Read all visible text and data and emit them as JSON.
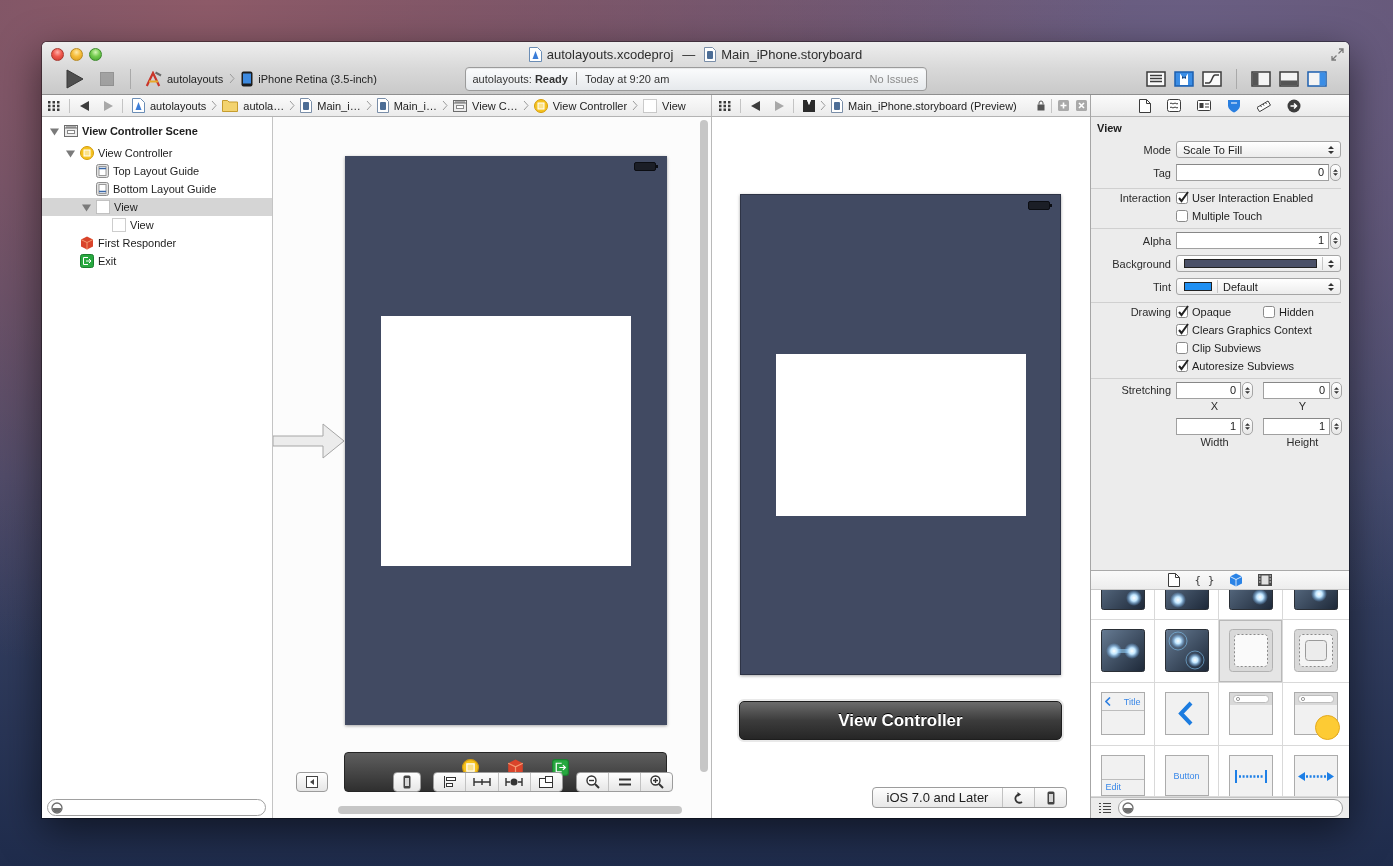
{
  "window": {
    "project": "autolayouts.xcodeproj",
    "separator": "—",
    "document": "Main_iPhone.storyboard"
  },
  "toolbar": {
    "stop_enabled": false,
    "scheme": "autolayouts",
    "destination": "iPhone Retina (3.5-inch)",
    "activity": {
      "status": "autolayouts: **Ready**",
      "time": "Today at 9:20 am",
      "issues": "No Issues"
    },
    "editor_modes": [
      {
        "kind": "standard",
        "selected": false
      },
      {
        "kind": "assistant",
        "selected": true
      },
      {
        "kind": "version",
        "selected": false
      }
    ],
    "view_toggles": [
      {
        "kind": "navigator",
        "selected": false
      },
      {
        "kind": "debug",
        "selected": false
      },
      {
        "kind": "utilities",
        "selected": true
      }
    ]
  },
  "editor": {
    "history": {
      "back_enabled": true,
      "forward_enabled": false
    },
    "jump_bar": [
      {
        "kind": "project",
        "label": "autolayouts"
      },
      {
        "kind": "folder",
        "label": "autola…"
      },
      {
        "kind": "storyboard",
        "label": "Main_i…"
      },
      {
        "kind": "storyboard",
        "label": "Main_i…"
      },
      {
        "kind": "scene",
        "label": "View C…"
      },
      {
        "kind": "controller",
        "label": "View Controller"
      },
      {
        "kind": "view",
        "label": "View"
      }
    ],
    "outline": [
      {
        "kind": "scene",
        "label": "View Controller Scene",
        "expanded": true,
        "selected": false,
        "children": [
          {
            "kind": "controller",
            "label": "View Controller",
            "expanded": true,
            "selected": false,
            "children": [
              {
                "kind": "top-guide",
                "label": "Top Layout Guide",
                "selected": false
              },
              {
                "kind": "bottom-guide",
                "label": "Bottom Layout Guide",
                "selected": false
              },
              {
                "kind": "view",
                "label": "View",
                "expanded": true,
                "selected": true,
                "children": [
                  {
                    "kind": "view",
                    "label": "View",
                    "selected": false
                  }
                ]
              }
            ]
          },
          {
            "kind": "responder",
            "label": "First Responder",
            "selected": false
          },
          {
            "kind": "exit",
            "label": "Exit",
            "selected": false
          }
        ]
      }
    ]
  },
  "assistant": {
    "history": {
      "back_enabled": true,
      "forward_enabled": false
    },
    "jump_bar": [
      {
        "kind": "storyboard",
        "label": "Main_iPhone.storyboard (Preview)"
      }
    ],
    "preview_title": "View Controller",
    "deployment": "iOS 7.0 and Later"
  },
  "inspector": {
    "tabs": [
      {
        "kind": "file",
        "selected": false
      },
      {
        "kind": "help",
        "selected": false
      },
      {
        "kind": "identity",
        "selected": false
      },
      {
        "kind": "attributes",
        "selected": true
      },
      {
        "kind": "size",
        "selected": false
      },
      {
        "kind": "connections",
        "selected": false
      }
    ],
    "title": "View",
    "groups": [
      {
        "rows": [
          {
            "kind": "popup",
            "label": "Mode",
            "value": "Scale To Fill"
          },
          {
            "kind": "stepper",
            "label": "Tag",
            "value": "0"
          }
        ]
      },
      {
        "rows": [
          {
            "kind": "checks",
            "label": "Interaction",
            "checks": [
              {
                "label": "User Interaction Enabled",
                "checked": true
              }
            ]
          },
          {
            "kind": "checks",
            "checks": [
              {
                "label": "Multiple Touch",
                "checked": false
              }
            ]
          }
        ]
      },
      {
        "rows": [
          {
            "kind": "stepper",
            "label": "Alpha",
            "value": "1"
          },
          {
            "kind": "color",
            "label": "Background",
            "color": "#4b5168"
          },
          {
            "kind": "color",
            "label": "Tint",
            "color": "#1e8ff2",
            "value": "Default"
          }
        ]
      },
      {
        "rows": [
          {
            "kind": "checks",
            "label": "Drawing",
            "checks": [
              {
                "label": "Opaque",
                "checked": true
              },
              {
                "label": "Hidden",
                "checked": false
              }
            ]
          },
          {
            "kind": "checks",
            "checks": [
              {
                "label": "Clears Graphics Context",
                "checked": true
              }
            ]
          },
          {
            "kind": "checks",
            "checks": [
              {
                "label": "Clip Subviews",
                "checked": false
              }
            ]
          },
          {
            "kind": "checks",
            "checks": [
              {
                "label": "Autoresize Subviews",
                "checked": true
              }
            ]
          }
        ]
      },
      {
        "rows": [
          {
            "kind": "pair",
            "label": "Stretching",
            "fields": [
              {
                "value": "0",
                "caption": "X"
              },
              {
                "value": "0",
                "caption": "Y"
              }
            ]
          },
          {
            "kind": "pair",
            "fields": [
              {
                "value": "1",
                "caption": "Width"
              },
              {
                "value": "1",
                "caption": "Height"
              }
            ]
          }
        ]
      }
    ]
  },
  "library": {
    "tabs": [
      {
        "kind": "file",
        "selected": false
      },
      {
        "kind": "snippet",
        "glyph": "{ }",
        "selected": false
      },
      {
        "kind": "object",
        "selected": true
      },
      {
        "kind": "media",
        "selected": false
      }
    ],
    "items": [
      {
        "kind": "glow",
        "selected": false
      },
      {
        "kind": "glow",
        "selected": false
      },
      {
        "kind": "glow",
        "selected": false
      },
      {
        "kind": "glow",
        "selected": false
      },
      {
        "kind": "glow-pair",
        "selected": false
      },
      {
        "kind": "glow-rings",
        "selected": false
      },
      {
        "kind": "view",
        "selected": true
      },
      {
        "kind": "container",
        "selected": false
      },
      {
        "kind": "navigation-bar",
        "label": "Title",
        "selected": false
      },
      {
        "kind": "navigation-item",
        "selected": false
      },
      {
        "kind": "search-bar",
        "selected": false
      },
      {
        "kind": "search-display",
        "selected": false
      },
      {
        "kind": "toolbar",
        "label": "Edit",
        "selected": false
      },
      {
        "kind": "bar-button",
        "label": "Button",
        "selected": false
      },
      {
        "kind": "fixed-space",
        "selected": false
      },
      {
        "kind": "flexible-space",
        "selected": false
      }
    ]
  }
}
